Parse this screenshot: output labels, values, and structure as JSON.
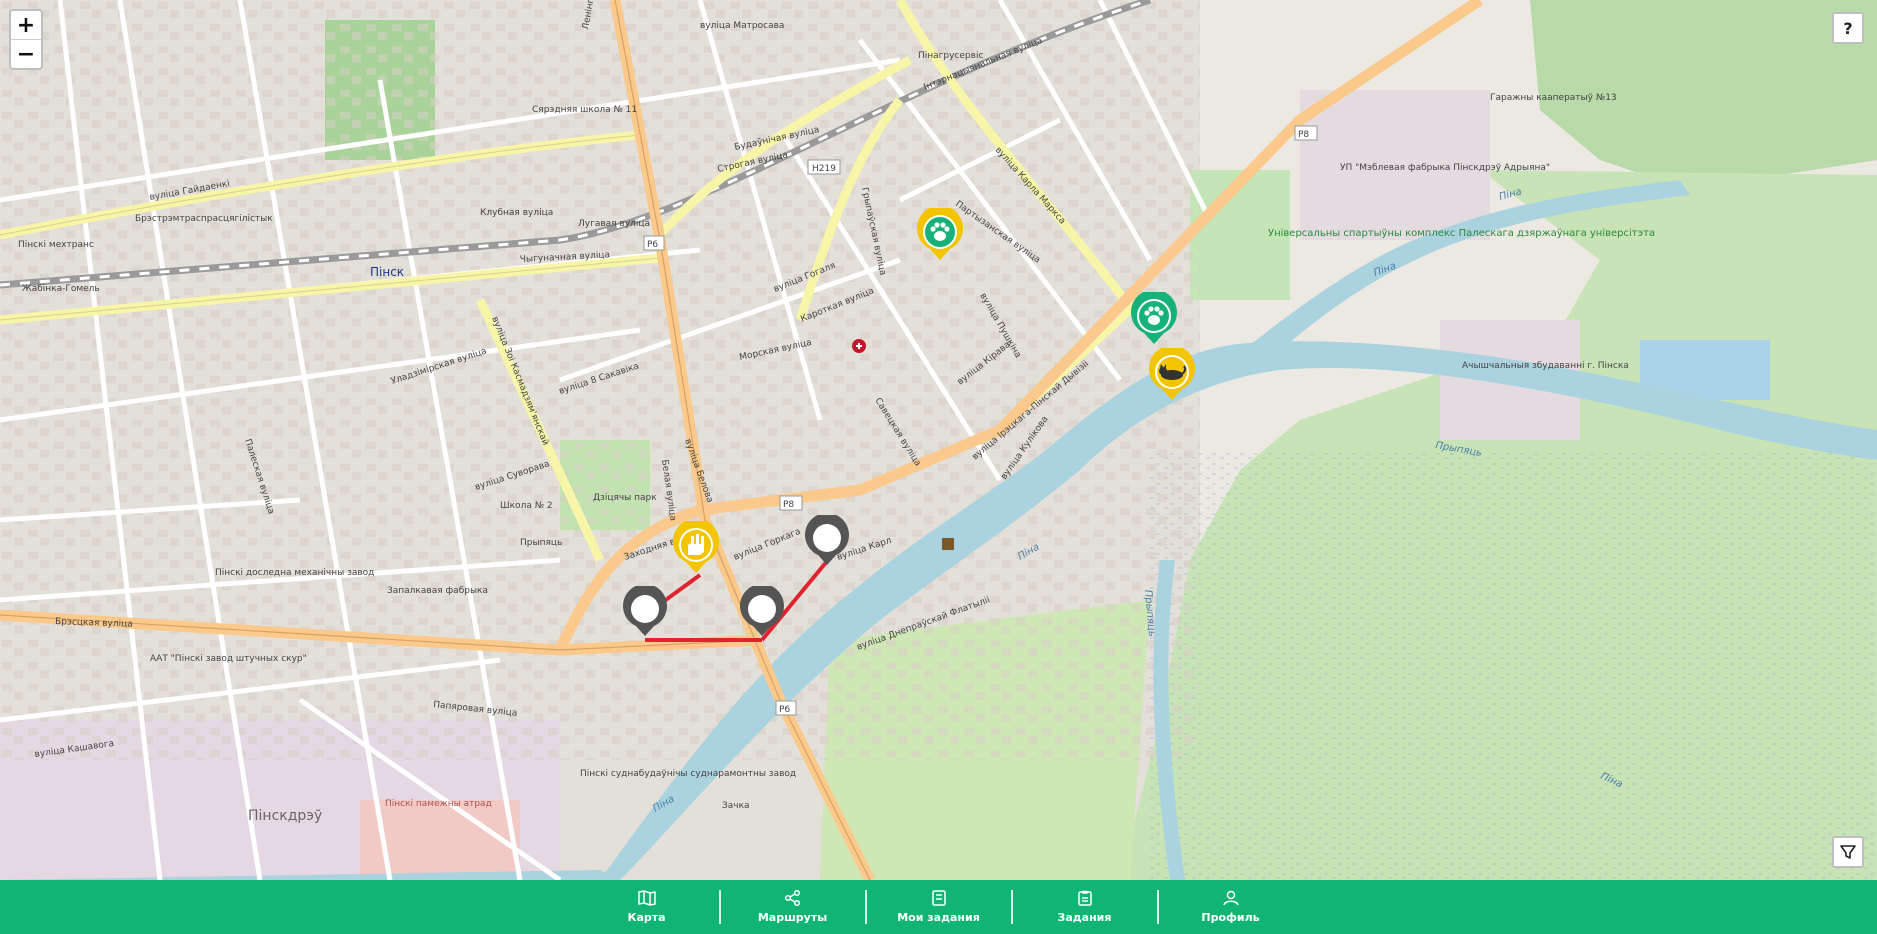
{
  "map": {
    "street_labels": [
      "вуліца Гайдаенкі",
      "Чыгуначная вуліца",
      "Клубная вуліца",
      "Лугавая вуліца",
      "Ленінградская вуліца",
      "вуліца Матросава",
      "Будаўнічая вуліца",
      "Строгая вуліца",
      "вуліца Гогаля",
      "Кароткая вуліца",
      "Інтэрнацыянальная вуліца",
      "Партызанская вуліца",
      "вуліца Карла Маркса",
      "вуліца Кірава",
      "вуліца Ірэцкага-Пінскай Дывізіі",
      "вуліца Пушкіна",
      "вуліца Кулікова",
      "вуліца Белова",
      "вуліца Горкага",
      "Заходняя вуліца",
      "Брэсцкая вуліца",
      "вуліца Днепраўскай Флатыліі",
      "вуліца Суворава",
      "Палеская вуліца",
      "Папяровая вуліца",
      "вуліца Кашавога",
      "вуліца Зоі Касмадзям'янскай",
      "Уладзімірская вуліца",
      "вуліца 8 Сакавіка",
      "Морская вуліца",
      "Савецкая вуліца",
      "Грыпаўская вуліца",
      "Белая вуліца",
      "вуліца Карл"
    ],
    "road_refs": [
      "H219",
      "P6",
      "P8",
      "P8",
      "P6"
    ],
    "place_labels": [
      "Пінск",
      "Пінскдрэў",
      "Пінскі мехтранс",
      "Брэстрэмтраспрасцягілістык",
      "Сярэдняя школа № 11",
      "Дзіцячы парк",
      "Школа № 2",
      "Прыпяць",
      "Універсальны спартыўны комплекс Палескага дзяржаўнага універсітэта",
      "УП \"Мэблевая фабрыка Пінскдрэў Адрыяна\"",
      "Гаражны кааператыў №13",
      "Ачышчальныя збудаванні г. Пінска",
      "ААТ \"Пінскі завод штучных скур\"",
      "Пінскі доследна механічны завод",
      "Запалкавая фабрыка",
      "Пінскі суднабудаўнічы суднарамонтны завод",
      "Пінскі памежны атрад",
      "Пінагрусервіс",
      "Жабінка-Гомель",
      "Зачка"
    ],
    "water_labels": [
      "Піна",
      "Піна",
      "Піна",
      "Прыпяць",
      "Прыпяць",
      "Піна",
      "Піна"
    ],
    "markers": [
      {
        "name": "paw-marker-yellow",
        "color": "#f2c500",
        "icon": "paw-icon"
      },
      {
        "name": "paw-marker-green",
        "color": "#16b27a",
        "icon": "paw-icon"
      },
      {
        "name": "cat-marker-yellow",
        "color": "#f2c500",
        "icon": "cat-icon"
      },
      {
        "name": "hand-marker-yellow",
        "color": "#f2c500",
        "icon": "hand-icon"
      }
    ],
    "route": {
      "color": "#e0242f",
      "waypoint_count": 3
    }
  },
  "controls": {
    "zoom_in": "+",
    "zoom_out": "−",
    "help": "?",
    "filter_icon": "filter-icon"
  },
  "navbar": {
    "color": "#10b573",
    "items": [
      {
        "label": "Карта",
        "icon": "map-book-icon"
      },
      {
        "label": "Маршруты",
        "icon": "share-nodes-icon"
      },
      {
        "label": "Мои задания",
        "icon": "notebook-icon"
      },
      {
        "label": "Задания",
        "icon": "clipboard-icon"
      },
      {
        "label": "Профиль",
        "icon": "user-icon"
      }
    ]
  }
}
